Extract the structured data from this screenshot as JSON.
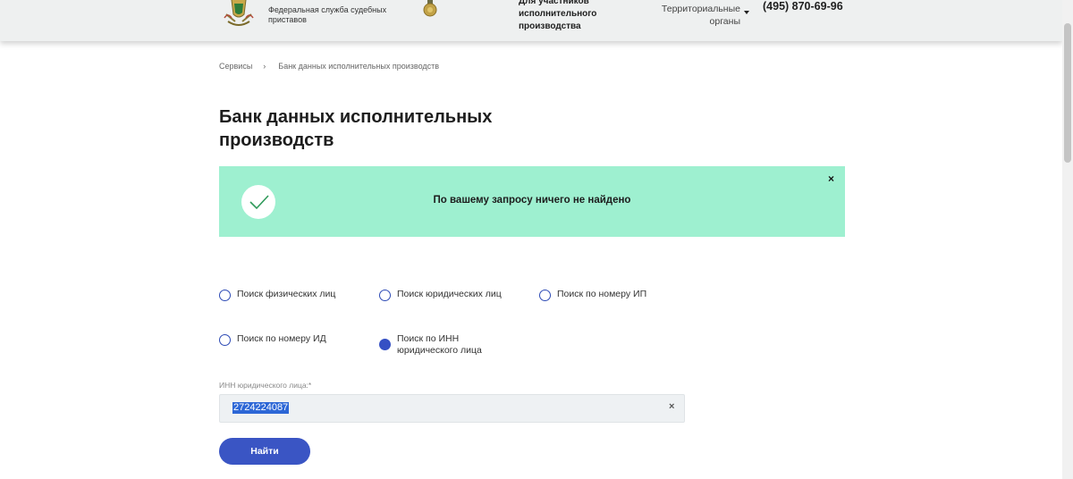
{
  "header": {
    "org_name": "Федеральная служба судебных приставов",
    "nav_participants": "Для участников исполнительного производства",
    "nav_territorial": "Территориальные органы",
    "phone": "(495) 870-69-96"
  },
  "breadcrumb": {
    "items": [
      "Сервисы",
      "Банк данных исполнительных производств"
    ],
    "separator": "›"
  },
  "page_title": "Банк данных исполнительных производств",
  "alert": {
    "message": "По вашему запросу ничего не найдено",
    "close": "×",
    "background": "#9ef0d0"
  },
  "search_options": [
    {
      "label": "Поиск физических лиц",
      "checked": false
    },
    {
      "label": "Поиск юридических лиц",
      "checked": false
    },
    {
      "label": "Поиск по номеру ИП",
      "checked": false
    },
    {
      "label": "Поиск по номеру ИД",
      "checked": false
    },
    {
      "label": "Поиск по ИНН юридического лица",
      "checked": true
    }
  ],
  "form": {
    "inn_label": "ИНН юридического лица:*",
    "inn_value": "2724224087",
    "clear": "×",
    "submit_label": "Найти"
  },
  "colors": {
    "accent": "#3a55c4",
    "alert_bg": "#9ef0d0",
    "selection": "#2d67d6"
  }
}
